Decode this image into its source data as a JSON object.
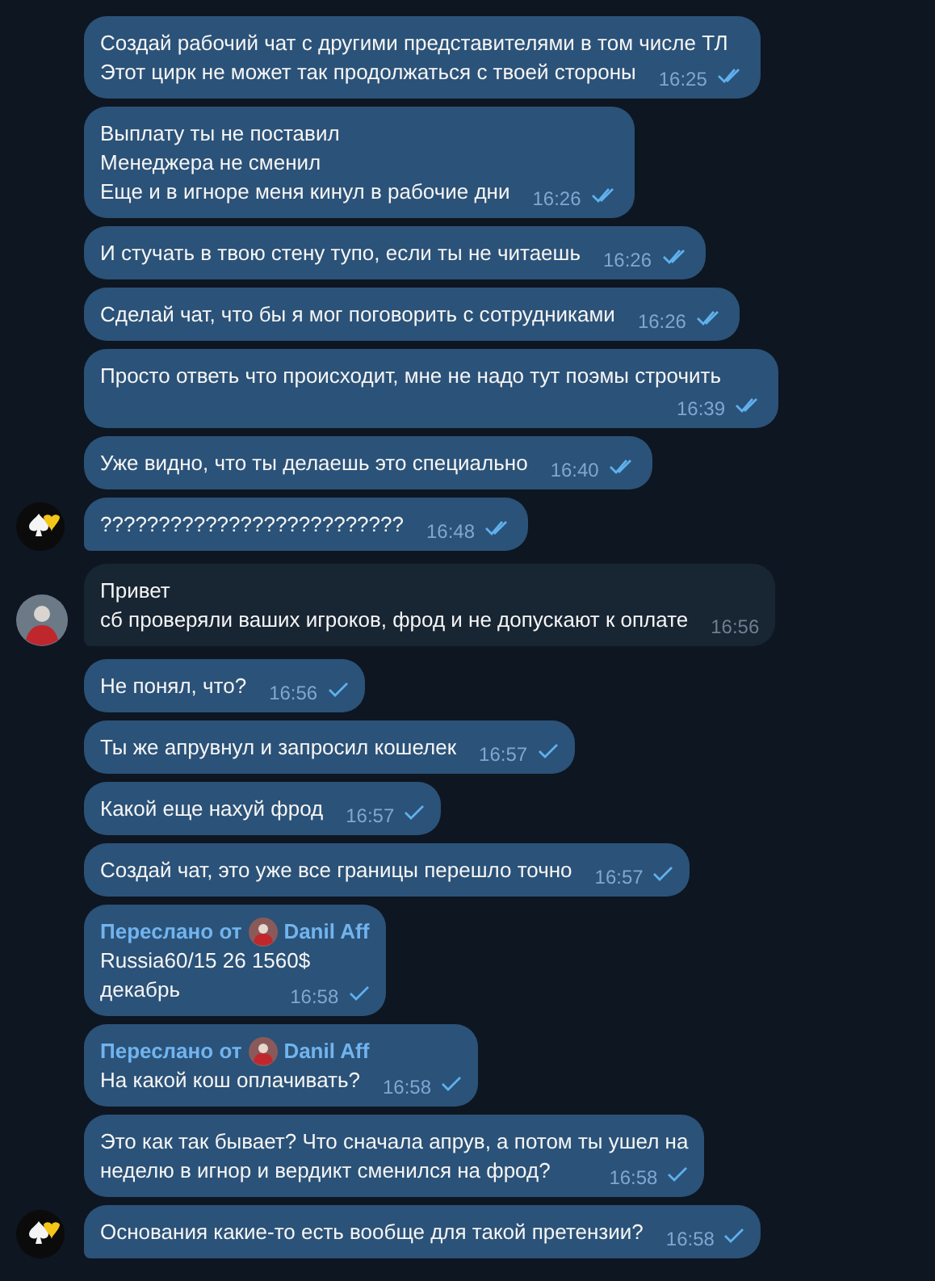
{
  "groups": [
    {
      "kind": "outgoing",
      "messages": [
        {
          "kind": "text",
          "lines": [
            "Создай рабочий чат с другими представителями в том числе ТЛ",
            "Этот цирк не может так продолжаться с твоей стороны"
          ],
          "time": "16:25",
          "read": true
        },
        {
          "kind": "text",
          "lines": [
            "Выплату ты не поставил",
            "Менеджера не сменил",
            "Еще и в игноре меня кинул в рабочие дни"
          ],
          "time": "16:26",
          "read": true
        },
        {
          "kind": "text",
          "lines": [
            "И стучать в твою стену тупо, если ты не читаешь"
          ],
          "time": "16:26",
          "read": true
        },
        {
          "kind": "text",
          "lines": [
            "Сделай чат, что бы я мог поговорить с сотрудниками"
          ],
          "time": "16:26",
          "read": true
        },
        {
          "kind": "text",
          "lines": [
            "Просто ответь что происходит, мне не надо тут поэмы строчить"
          ],
          "time": "16:39",
          "read": true
        },
        {
          "kind": "text",
          "lines": [
            "Уже видно, что ты делаешь это специально"
          ],
          "time": "16:40",
          "read": true
        },
        {
          "kind": "text",
          "lines": [
            "??????????????????????????"
          ],
          "time": "16:48",
          "read": true
        }
      ]
    },
    {
      "kind": "incoming",
      "messages": [
        {
          "kind": "text",
          "lines": [
            "Привет",
            "сб проверяли ваших игроков, фрод и не допускают к оплате"
          ],
          "time": "16:56"
        }
      ]
    },
    {
      "kind": "outgoing",
      "messages": [
        {
          "kind": "text",
          "lines": [
            "Не понял, что?"
          ],
          "time": "16:56",
          "read": false
        },
        {
          "kind": "text",
          "lines": [
            "Ты же апрувнул и запросил кошелек"
          ],
          "time": "16:57",
          "read": false
        },
        {
          "kind": "text",
          "lines": [
            "Какой еще нахуй фрод"
          ],
          "time": "16:57",
          "read": false
        },
        {
          "kind": "text",
          "lines": [
            "Создай чат, это уже все границы перешло точно"
          ],
          "time": "16:57",
          "read": false
        },
        {
          "kind": "forwarded",
          "forward_label": "Переслано от",
          "forward_name": "Danil Aff",
          "lines": [
            "Russia60/15 26 1560$",
            "декабрь"
          ],
          "time": "16:58",
          "read": false
        },
        {
          "kind": "forwarded",
          "forward_label": "Переслано от",
          "forward_name": "Danil Aff",
          "lines": [
            "На какой кош оплачивать?"
          ],
          "time": "16:58",
          "read": false
        },
        {
          "kind": "text",
          "lines": [
            "Это как так бывает? Что сначала апрув, а потом ты ушел на",
            "неделю в игнор и вердикт сменился на фрод?"
          ],
          "time": "16:58",
          "read": false
        },
        {
          "kind": "text",
          "lines": [
            "Основания какие-то есть вообще для такой претензии?"
          ],
          "time": "16:58",
          "read": false
        }
      ]
    }
  ]
}
